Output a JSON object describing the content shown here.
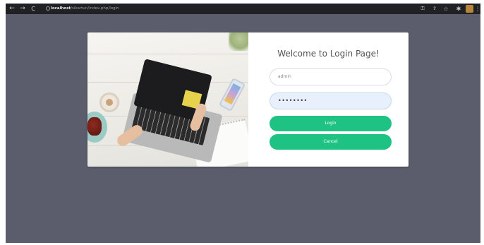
{
  "browser": {
    "back_icon": "arrow-left-icon",
    "forward_icon": "arrow-right-icon",
    "reload_icon": "reload-icon",
    "url_host": "localhost",
    "url_path": "/sikartun/index.php/login",
    "right_icons": [
      "key-icon",
      "share-icon",
      "star-icon",
      "extensions-icon",
      "profile-avatar",
      "menu-icon"
    ]
  },
  "login": {
    "title": "Welcome to Login Page!",
    "username_placeholder": "admin",
    "password_value": "••••••••",
    "login_label": "Login",
    "cancel_label": "Cancel"
  },
  "colors": {
    "background": "#5b5d6c",
    "toolbar": "#202124",
    "button": "#1ec283",
    "password_fill": "#e8f0fe"
  }
}
